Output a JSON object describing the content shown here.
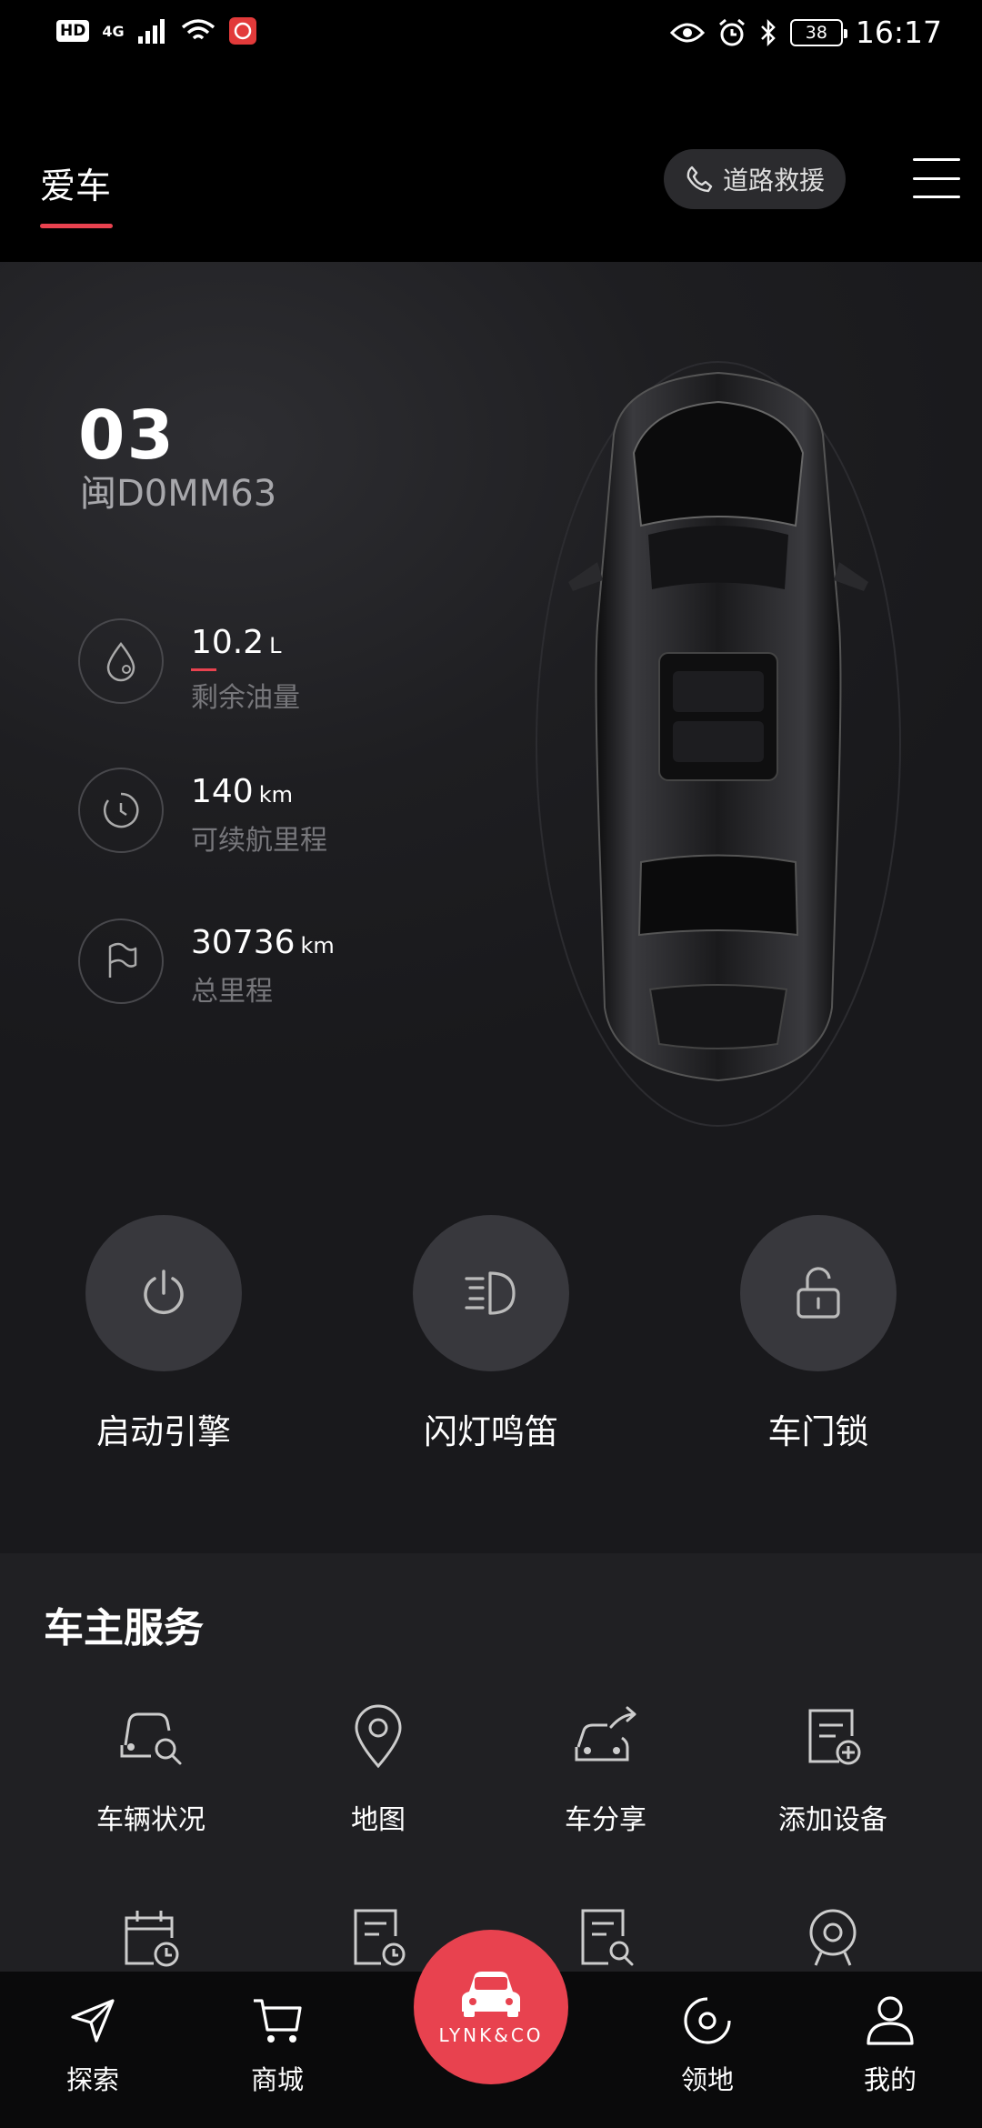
{
  "status_bar": {
    "hd": "HD",
    "network": "4G",
    "battery": "38",
    "time": "16:17"
  },
  "header": {
    "tab_label": "爱车",
    "rescue_label": "道路救援"
  },
  "vehicle": {
    "model": "03",
    "plate": "闽D0MM63",
    "stats": [
      {
        "value": "10.2",
        "unit": "L",
        "label": "剩余油量",
        "icon": "fuel-drop-icon"
      },
      {
        "value": "140",
        "unit": "km",
        "label": "可续航里程",
        "icon": "range-gauge-icon"
      },
      {
        "value": "30736",
        "unit": "km",
        "label": "总里程",
        "icon": "flag-icon"
      }
    ]
  },
  "controls": [
    {
      "label": "启动引擎",
      "icon": "power-icon"
    },
    {
      "label": "闪灯鸣笛",
      "icon": "headlight-icon"
    },
    {
      "label": "车门锁",
      "icon": "unlock-icon"
    }
  ],
  "services": {
    "title": "车主服务",
    "items": [
      {
        "label": "车辆状况",
        "icon": "car-search-icon"
      },
      {
        "label": "地图",
        "icon": "map-pin-icon"
      },
      {
        "label": "车分享",
        "icon": "car-share-icon"
      },
      {
        "label": "添加设备",
        "icon": "add-device-icon"
      }
    ],
    "row2_icons": [
      "calendar-clock-icon",
      "document-clock-icon",
      "document-search-icon",
      "camera-icon"
    ]
  },
  "bottom_nav": {
    "items": [
      {
        "label": "探索",
        "icon": "send-icon"
      },
      {
        "label": "商城",
        "icon": "cart-icon"
      },
      {
        "label": "领地",
        "icon": "target-icon"
      },
      {
        "label": "我的",
        "icon": "user-icon"
      }
    ],
    "center_brand": "LYNK&CO"
  },
  "colors": {
    "accent": "#e8424f",
    "background": "#000000",
    "card": "#202023",
    "control_circle": "#38383d"
  }
}
